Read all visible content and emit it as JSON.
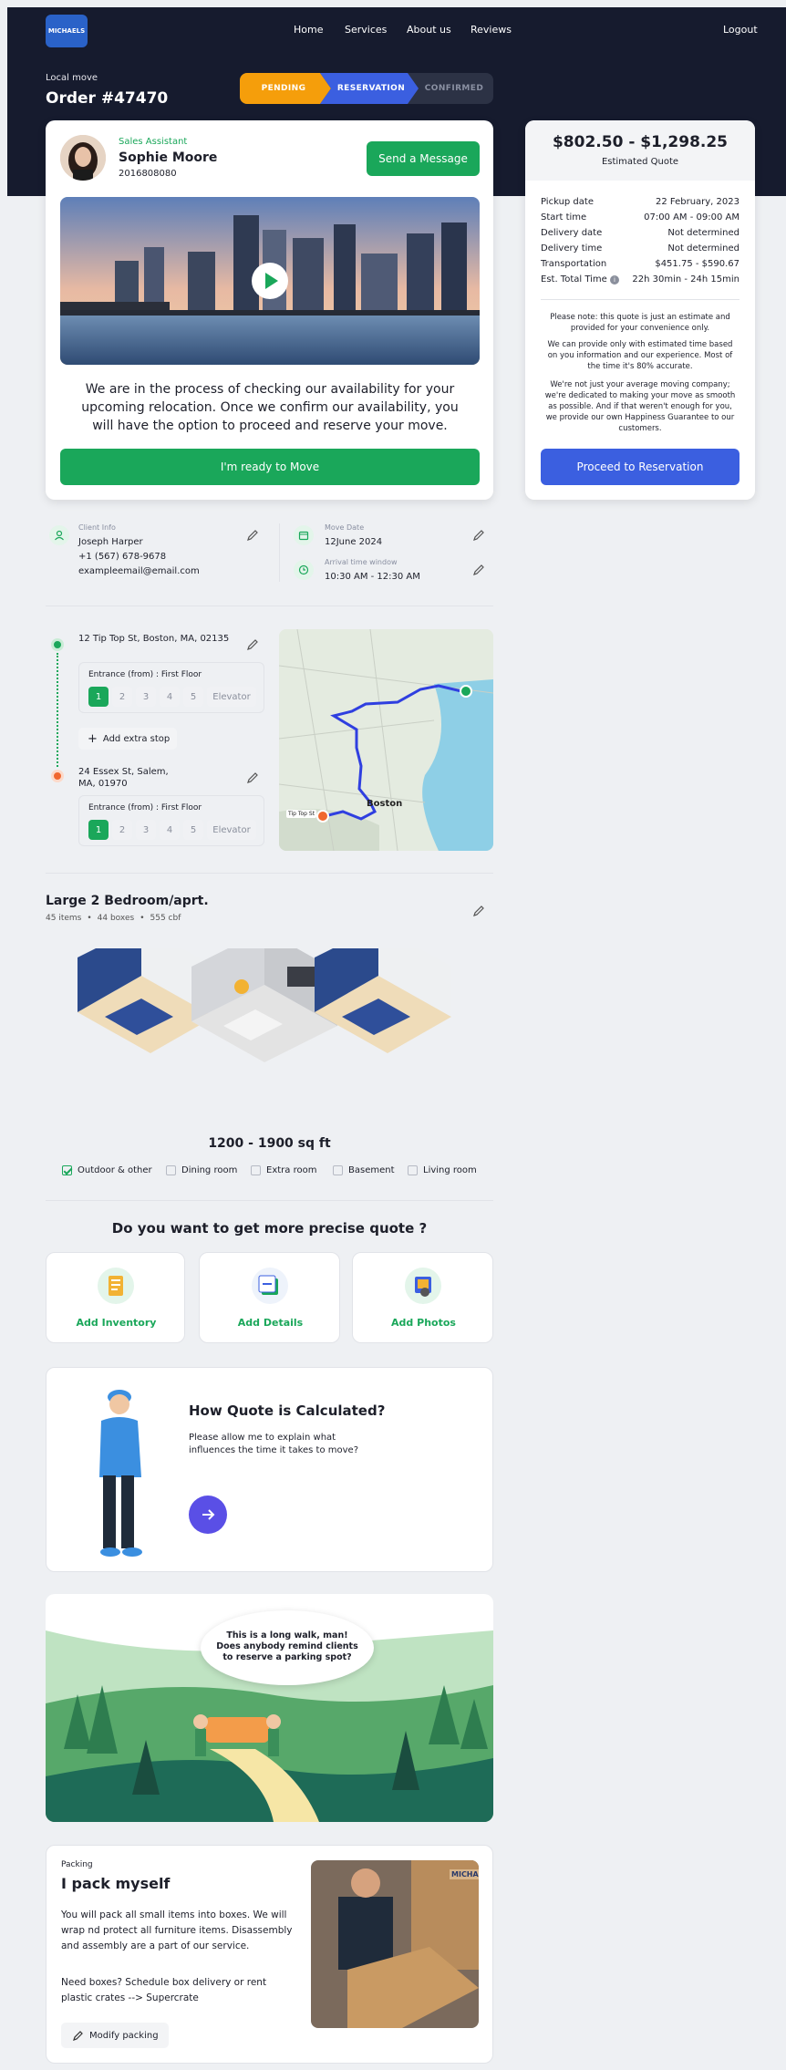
{
  "header": {
    "logo_text": "MICHAELS",
    "nav": [
      "Home",
      "Services",
      "About us",
      "Reviews"
    ],
    "logout": "Logout",
    "move_type": "Local move",
    "order_title": "Order #47470",
    "steps": [
      "PENDING",
      "RESERVATION",
      "CONFIRMED"
    ]
  },
  "assistant": {
    "role": "Sales Assistant",
    "name": "Sophie Moore",
    "phone": "2016808080",
    "message_button": "Send a Message",
    "status_message": "We are in the process of checking our availability for your upcoming relocation. Once we confirm our availability, you will have the option to proceed and reserve your move.",
    "ready_button": "I'm ready to Move"
  },
  "quote": {
    "range": "$802.50 - $1,298.25",
    "label": "Estimated Quote",
    "rows": [
      {
        "label": "Pickup date",
        "value": "22 February, 2023"
      },
      {
        "label": "Start time",
        "value": "07:00 AM - 09:00 AM"
      },
      {
        "label": "Delivery date",
        "value": "Not determined"
      },
      {
        "label": "Delivery time",
        "value": "Not determined"
      },
      {
        "label": "Transportation",
        "value": "$451.75 - $590.67"
      },
      {
        "label": "Est. Total Time",
        "value": "22h 30min - 24h 15min"
      }
    ],
    "note1": "Please note: this quote is just an estimate and provided for your convenience only.",
    "note2": "We can provide only with estimated time based on you information and our experience. Most of the time it's 80% accurate.",
    "note3": "We're not just your average moving company; we're dedicated to making your move as smooth as possible. And if that weren't enough for you, we provide our own Happiness Guarantee to our customers.",
    "proceed_button": "Proceed to Reservation",
    "accent": "#3b5fe0"
  },
  "client": {
    "label": "Client Info",
    "name": "Joseph Harper",
    "phone": "+1 (567) 678-9678",
    "email": "exampleemail@email.com",
    "move_date_label": "Move Date",
    "move_date": "12June 2024",
    "arrival_label": "Arrival time window",
    "arrival": "10:30 AM - 12:30 AM"
  },
  "route": {
    "origin": "12 Tip Top St, Boston, MA, 02135",
    "origin_entrance": "Entrance (from) : First Floor",
    "add_stop": "Add extra stop",
    "destination": "24 Essex St, Salem, MA, 01970",
    "dest_entrance": "Entrance (from) : First Floor",
    "floors": [
      "1",
      "2",
      "3",
      "4",
      "5"
    ],
    "elevator": "Elevator",
    "map_city": "Boston",
    "map_tag": "Tip Top St"
  },
  "home": {
    "title": "Large 2 Bedroom/aprt.",
    "items": "45 items",
    "boxes": "44 boxes",
    "cbf": "555 cbf",
    "sqft": "1200 - 1900 sq ft",
    "rooms": [
      {
        "label": "Outdoor & other",
        "checked": true
      },
      {
        "label": "Dining room",
        "checked": false
      },
      {
        "label": "Extra room",
        "checked": false
      },
      {
        "label": "Basement",
        "checked": false
      },
      {
        "label": "Living room",
        "checked": false
      }
    ]
  },
  "precise": {
    "title": "Do you want to get more precise quote ?",
    "options": [
      "Add Inventory",
      "Add Details",
      "Add Photos"
    ]
  },
  "calc": {
    "title": "How Quote is Calculated?",
    "body": "Please allow me to explain what influences the time it takes to move?"
  },
  "parking": {
    "bubble": "This is a long walk, man! Does anybody remind clients to reserve a parking spot?"
  },
  "packing": {
    "label": "Packing",
    "title": "I pack myself",
    "body1": "You will pack all small items into boxes. We will wrap nd protect all furniture items. Disassembly and assembly are a part of our service.",
    "body2": "Need boxes? Schedule box delivery or rent plastic crates --> Supercrate",
    "modify_button": "Modify packing",
    "box_text": "MICHAELS"
  }
}
